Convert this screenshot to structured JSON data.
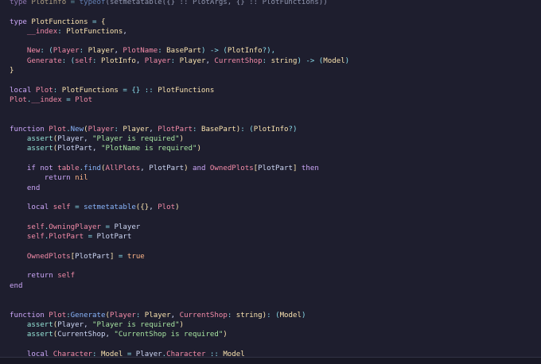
{
  "editor": {
    "language": "luau",
    "lines": [
      [
        {
          "t": "type ",
          "c": "k"
        },
        {
          "t": "PlotInfo",
          "c": "t"
        },
        {
          "t": " = ",
          "c": "o"
        },
        {
          "t": "typeof",
          "c": "f"
        },
        {
          "t": "(setmetatable({} :: PlotArgs, {} :: PlotFunctions))",
          "c": "p"
        }
      ],
      [],
      [
        {
          "t": "type ",
          "c": "k"
        },
        {
          "t": "PlotFunctions",
          "c": "t"
        },
        {
          "t": " = ",
          "c": "o"
        },
        {
          "t": "{",
          "c": "b"
        }
      ],
      [
        {
          "t": "    __index",
          "c": "v"
        },
        {
          "t": ": ",
          "c": "o"
        },
        {
          "t": "PlotFunctions",
          "c": "t"
        },
        {
          "t": ",",
          "c": "p"
        }
      ],
      [],
      [
        {
          "t": "    New",
          "c": "v"
        },
        {
          "t": ": (",
          "c": "o"
        },
        {
          "t": "Player",
          "c": "v"
        },
        {
          "t": ": ",
          "c": "o"
        },
        {
          "t": "Player",
          "c": "t"
        },
        {
          "t": ", ",
          "c": "p"
        },
        {
          "t": "PlotName",
          "c": "v"
        },
        {
          "t": ": ",
          "c": "o"
        },
        {
          "t": "BasePart",
          "c": "t"
        },
        {
          "t": ") -> (",
          "c": "o"
        },
        {
          "t": "PlotInfo",
          "c": "t"
        },
        {
          "t": "?),",
          "c": "o"
        }
      ],
      [
        {
          "t": "    Generate",
          "c": "v"
        },
        {
          "t": ": (",
          "c": "o"
        },
        {
          "t": "self",
          "c": "v"
        },
        {
          "t": ": ",
          "c": "o"
        },
        {
          "t": "PlotInfo",
          "c": "t"
        },
        {
          "t": ", ",
          "c": "p"
        },
        {
          "t": "Player",
          "c": "v"
        },
        {
          "t": ": ",
          "c": "o"
        },
        {
          "t": "Player",
          "c": "t"
        },
        {
          "t": ", ",
          "c": "p"
        },
        {
          "t": "CurrentShop",
          "c": "v"
        },
        {
          "t": ": ",
          "c": "o"
        },
        {
          "t": "string",
          "c": "t"
        },
        {
          "t": ") -> (",
          "c": "o"
        },
        {
          "t": "Model",
          "c": "t"
        },
        {
          "t": ")",
          "c": "o"
        }
      ],
      [
        {
          "t": "}",
          "c": "b"
        }
      ],
      [],
      [
        {
          "t": "local ",
          "c": "k"
        },
        {
          "t": "Plot",
          "c": "v"
        },
        {
          "t": ": ",
          "c": "o"
        },
        {
          "t": "PlotFunctions",
          "c": "t"
        },
        {
          "t": " = {} :: ",
          "c": "o"
        },
        {
          "t": "PlotFunctions",
          "c": "t"
        }
      ],
      [
        {
          "t": "Plot",
          "c": "v"
        },
        {
          "t": ".",
          "c": "o"
        },
        {
          "t": "__index",
          "c": "v"
        },
        {
          "t": " = ",
          "c": "o"
        },
        {
          "t": "Plot",
          "c": "v"
        }
      ],
      [],
      [],
      [
        {
          "t": "function ",
          "c": "k"
        },
        {
          "t": "Plot",
          "c": "v"
        },
        {
          "t": ".",
          "c": "o"
        },
        {
          "t": "New",
          "c": "f"
        },
        {
          "t": "(",
          "c": "b"
        },
        {
          "t": "Player",
          "c": "v"
        },
        {
          "t": ": ",
          "c": "o"
        },
        {
          "t": "Player",
          "c": "t"
        },
        {
          "t": ", ",
          "c": "p"
        },
        {
          "t": "PlotPart",
          "c": "v"
        },
        {
          "t": ": ",
          "c": "o"
        },
        {
          "t": "BasePart",
          "c": "t"
        },
        {
          "t": ")",
          "c": "b"
        },
        {
          "t": ": (",
          "c": "o"
        },
        {
          "t": "PlotInfo",
          "c": "t"
        },
        {
          "t": "?)",
          "c": "o"
        }
      ],
      [
        {
          "t": "    assert",
          "c": "d"
        },
        {
          "t": "(",
          "c": "b"
        },
        {
          "t": "Player",
          "c": "p"
        },
        {
          "t": ", ",
          "c": "p"
        },
        {
          "t": "\"Player is required\"",
          "c": "s"
        },
        {
          "t": ")",
          "c": "b"
        }
      ],
      [
        {
          "t": "    assert",
          "c": "d"
        },
        {
          "t": "(",
          "c": "b"
        },
        {
          "t": "PlotPart",
          "c": "p"
        },
        {
          "t": ", ",
          "c": "p"
        },
        {
          "t": "\"PlotName is required\"",
          "c": "s"
        },
        {
          "t": ")",
          "c": "b"
        }
      ],
      [],
      [
        {
          "t": "    if not ",
          "c": "k"
        },
        {
          "t": "table",
          "c": "v"
        },
        {
          "t": ".",
          "c": "o"
        },
        {
          "t": "find",
          "c": "f"
        },
        {
          "t": "(",
          "c": "b"
        },
        {
          "t": "AllPlots",
          "c": "v"
        },
        {
          "t": ", ",
          "c": "p"
        },
        {
          "t": "PlotPart",
          "c": "p"
        },
        {
          "t": ")",
          "c": "b"
        },
        {
          "t": " and ",
          "c": "k"
        },
        {
          "t": "OwnedPlots",
          "c": "v"
        },
        {
          "t": "[",
          "c": "b"
        },
        {
          "t": "PlotPart",
          "c": "p"
        },
        {
          "t": "]",
          "c": "b"
        },
        {
          "t": " then",
          "c": "k"
        }
      ],
      [
        {
          "t": "        return ",
          "c": "k"
        },
        {
          "t": "nil",
          "c": "c"
        }
      ],
      [
        {
          "t": "    end",
          "c": "k"
        }
      ],
      [],
      [
        {
          "t": "    local ",
          "c": "k"
        },
        {
          "t": "self",
          "c": "v"
        },
        {
          "t": " = ",
          "c": "o"
        },
        {
          "t": "setmetatable",
          "c": "f"
        },
        {
          "t": "(",
          "c": "b"
        },
        {
          "t": "{}",
          "c": "b"
        },
        {
          "t": ", ",
          "c": "p"
        },
        {
          "t": "Plot",
          "c": "v"
        },
        {
          "t": ")",
          "c": "b"
        }
      ],
      [],
      [
        {
          "t": "    self",
          "c": "v"
        },
        {
          "t": ".",
          "c": "o"
        },
        {
          "t": "OwningPlayer",
          "c": "v"
        },
        {
          "t": " = ",
          "c": "o"
        },
        {
          "t": "Player",
          "c": "p"
        }
      ],
      [
        {
          "t": "    self",
          "c": "v"
        },
        {
          "t": ".",
          "c": "o"
        },
        {
          "t": "PlotPart",
          "c": "v"
        },
        {
          "t": " = ",
          "c": "o"
        },
        {
          "t": "PlotPart",
          "c": "p"
        }
      ],
      [],
      [
        {
          "t": "    OwnedPlots",
          "c": "v"
        },
        {
          "t": "[",
          "c": "b"
        },
        {
          "t": "PlotPart",
          "c": "p"
        },
        {
          "t": "]",
          "c": "b"
        },
        {
          "t": " = ",
          "c": "o"
        },
        {
          "t": "true",
          "c": "c"
        }
      ],
      [],
      [
        {
          "t": "    return ",
          "c": "k"
        },
        {
          "t": "self",
          "c": "v"
        }
      ],
      [
        {
          "t": "end",
          "c": "k"
        }
      ],
      [],
      [],
      [
        {
          "t": "function ",
          "c": "k"
        },
        {
          "t": "Plot",
          "c": "v"
        },
        {
          "t": ":",
          "c": "o"
        },
        {
          "t": "Generate",
          "c": "f"
        },
        {
          "t": "(",
          "c": "b"
        },
        {
          "t": "Player",
          "c": "v"
        },
        {
          "t": ": ",
          "c": "o"
        },
        {
          "t": "Player",
          "c": "t"
        },
        {
          "t": ", ",
          "c": "p"
        },
        {
          "t": "CurrentShop",
          "c": "v"
        },
        {
          "t": ": ",
          "c": "o"
        },
        {
          "t": "string",
          "c": "t"
        },
        {
          "t": ")",
          "c": "b"
        },
        {
          "t": ": (",
          "c": "o"
        },
        {
          "t": "Model",
          "c": "t"
        },
        {
          "t": ")",
          "c": "o"
        }
      ],
      [
        {
          "t": "    assert",
          "c": "d"
        },
        {
          "t": "(",
          "c": "b"
        },
        {
          "t": "Player",
          "c": "p"
        },
        {
          "t": ", ",
          "c": "p"
        },
        {
          "t": "\"Player is required\"",
          "c": "s"
        },
        {
          "t": ")",
          "c": "b"
        }
      ],
      [
        {
          "t": "    assert",
          "c": "d"
        },
        {
          "t": "(",
          "c": "b"
        },
        {
          "t": "CurrentShop",
          "c": "p"
        },
        {
          "t": ", ",
          "c": "p"
        },
        {
          "t": "\"CurrentShop is required\"",
          "c": "s"
        },
        {
          "t": ")",
          "c": "b"
        }
      ],
      [],
      [
        {
          "t": "    local ",
          "c": "k"
        },
        {
          "t": "Character",
          "c": "v"
        },
        {
          "t": ": ",
          "c": "o"
        },
        {
          "t": "Model",
          "c": "t"
        },
        {
          "t": " = ",
          "c": "o"
        },
        {
          "t": "Player",
          "c": "p"
        },
        {
          "t": ".",
          "c": "o"
        },
        {
          "t": "Character",
          "c": "v"
        },
        {
          "t": " :: ",
          "c": "o"
        },
        {
          "t": "Model",
          "c": "t"
        }
      ]
    ]
  },
  "statusbar": {
    "left": "",
    "right": ""
  },
  "colors": {
    "background": "#1e1e2e",
    "keyword": "#cba6f7",
    "type": "#f9e2af",
    "variable": "#f38ba8",
    "function": "#89b4fa",
    "string": "#a6e3a1",
    "operator": "#89dceb",
    "constant": "#fab387"
  }
}
